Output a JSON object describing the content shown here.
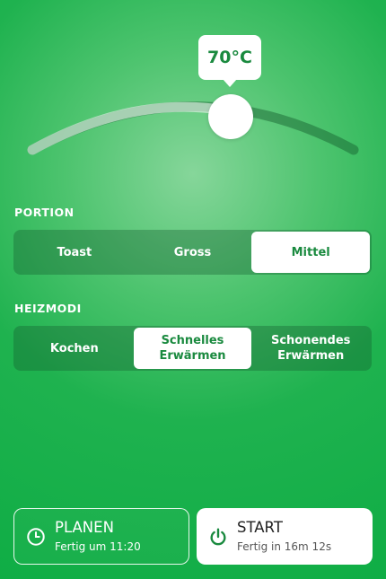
{
  "temperature": {
    "display": "70°C",
    "level": 0.63
  },
  "portion": {
    "label": "PORTION",
    "options": [
      "Toast",
      "Gross",
      "Mittel"
    ],
    "selected": "Mittel"
  },
  "heizmodi": {
    "label": "HEIZMODI",
    "options": [
      "Kochen",
      "Schnelles\nErwärmen",
      "Schonendes\nErwärmen"
    ],
    "selected": "Schnelles Erwärmen"
  },
  "plan_button": {
    "title": "PLANEN",
    "subtitle": "Fertig um 11:20",
    "icon": "clock-icon"
  },
  "start_button": {
    "title": "START",
    "subtitle": "Fertig in 16m 12s",
    "icon": "power-icon"
  },
  "colors": {
    "accent": "#1a8a3f",
    "background": "#11ad47"
  }
}
